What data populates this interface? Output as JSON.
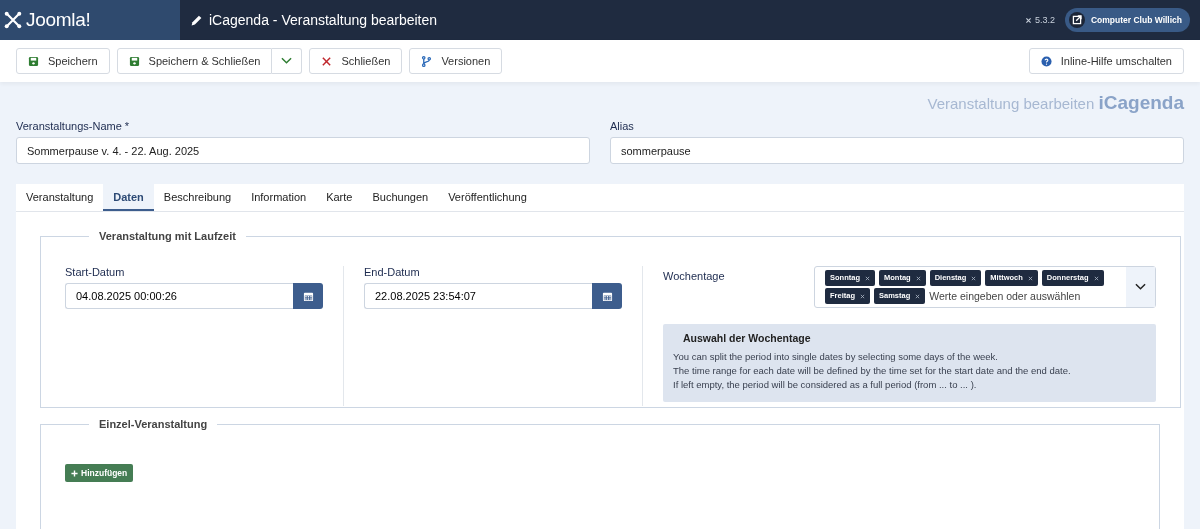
{
  "header": {
    "logo": "Joomla!",
    "title": "iCagenda - Veranstaltung bearbeiten",
    "version": "5.3.2",
    "site": "Computer Club Willich"
  },
  "toolbar": {
    "buttons": [
      {
        "label": "Speichern",
        "kind": "save"
      },
      {
        "label": "Speichern & Schließen",
        "kind": "save-split"
      },
      {
        "label": "Schließen",
        "kind": "close"
      },
      {
        "label": "Versionen",
        "kind": "versions"
      }
    ],
    "help": "Inline-Hilfe umschalten"
  },
  "page_heading": {
    "text": "Veranstaltung bearbeiten",
    "brand": "iCagenda"
  },
  "fields": [
    {
      "label": "Veranstaltungs-Name *",
      "value": "Sommerpause v. 4. - 22. Aug. 2025"
    },
    {
      "label": "Alias",
      "value": "sommerpause"
    }
  ],
  "tabs": [
    {
      "label": "Veranstaltung",
      "selected": false
    },
    {
      "label": "Daten",
      "selected": true
    },
    {
      "label": "Beschreibung",
      "selected": false
    },
    {
      "label": "Information",
      "selected": false
    },
    {
      "label": "Karte",
      "selected": false
    },
    {
      "label": "Buchungen",
      "selected": false
    },
    {
      "label": "Veröffentlichung",
      "selected": false
    }
  ],
  "period": {
    "legend": "Veranstaltung mit Laufzeit",
    "start": {
      "label": "Start-Datum",
      "value": "04.08.2025 00:00:26"
    },
    "end": {
      "label": "End-Datum",
      "value": "22.08.2025 23:54:07"
    },
    "weekdays": {
      "label": "Wochentage",
      "tags": [
        "Sonntag",
        "Montag",
        "Dienstag",
        "Mittwoch",
        "Donnerstag",
        "Freitag",
        "Samstag"
      ],
      "placeholder": "Werte eingeben oder auswählen"
    },
    "info": {
      "title": "Auswahl der Wochentage",
      "lines": [
        "You can split the period into single dates by selecting some days of the week.",
        "The time range for each date will be defined by the time set for the start date and the end date.",
        "If left empty, the period will be considered as a full period (from ... to ... )."
      ]
    }
  },
  "single": {
    "legend": "Einzel-Veranstaltung",
    "add_button": "Hinzufügen"
  }
}
